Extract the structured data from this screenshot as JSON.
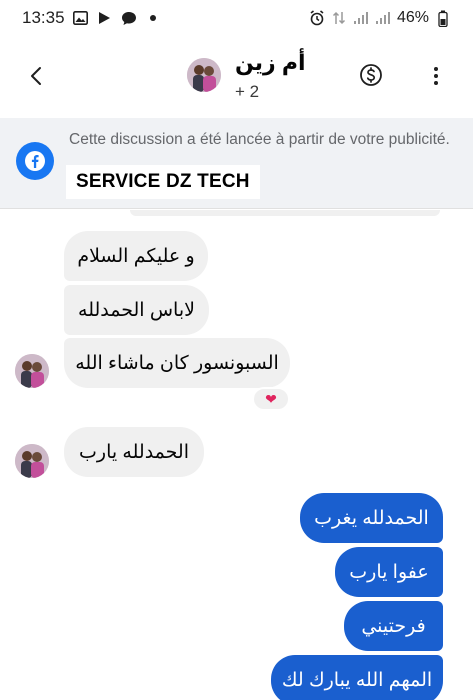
{
  "status_bar": {
    "time": "13:35",
    "left_icons": [
      "image-icon",
      "play-store-icon",
      "chat-bubble-icon",
      "dot-icon"
    ],
    "right_icons": [
      "alarm-icon",
      "data-arrows-icon",
      "signal-icon",
      "signal-icon"
    ],
    "battery": "46%"
  },
  "header": {
    "contact_name": "أم زين",
    "participants_extra": "+ 2"
  },
  "ad_banner": {
    "text": "Cette discussion a été lancée à partir de votre publicité.",
    "overlay_label": "SERVICE DZ TECH"
  },
  "messages": {
    "in_1": "و عليكم السلام",
    "in_2": "لاباس الحمدلله",
    "in_3": "السبونسور كان ماشاء الله",
    "in_3_reaction": "❤",
    "in_4": "الحمدلله يارب",
    "out_1": "الحمدلله يغرب",
    "out_2": "عفوا يارب",
    "out_3": "فرحتيني",
    "out_4": "المهم الله يبارك لك"
  },
  "colors": {
    "outgoing_bubble": "#1a5fcf",
    "incoming_bubble": "#f0f0f0",
    "facebook_blue": "#1877f2",
    "banner_bg": "#f0f2f5"
  }
}
